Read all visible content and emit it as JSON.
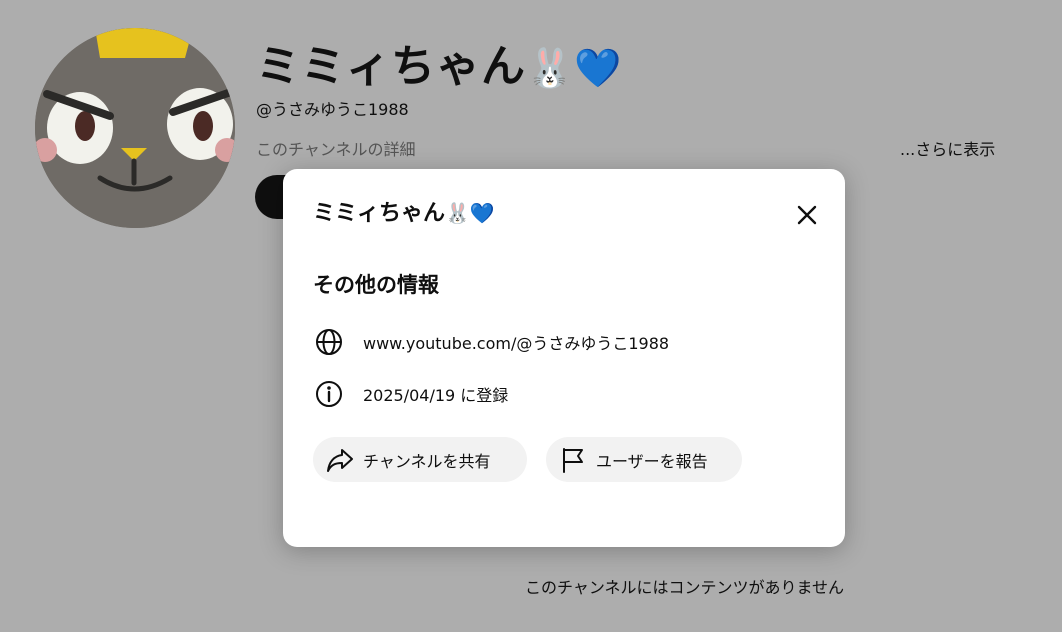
{
  "channel": {
    "name": "ミミィちゃん",
    "name_emoji": "🐰💙",
    "handle": "@うさみゆうこ1988",
    "description_link": "このチャンネルの詳細",
    "more_link": "...さらに表示",
    "empty_message": "このチャンネルにはコンテンツがありません"
  },
  "dialog": {
    "title": "ミミィちゃん",
    "title_emoji": "🐰💙",
    "section_heading": "その他の情報",
    "url": "www.youtube.com/@うさみゆうこ1988",
    "joined": "2025/04/19 に登録",
    "share_label": "チャンネルを共有",
    "report_label": "ユーザーを報告"
  },
  "icons": {
    "close": "close-icon",
    "globe": "globe-icon",
    "info": "info-icon",
    "share": "share-icon",
    "flag": "flag-icon"
  },
  "colors": {
    "overlay_bg": "#adadad",
    "dialog_bg": "#ffffff",
    "pill_bg": "#f2f2f2",
    "text": "#0f0f0f"
  }
}
